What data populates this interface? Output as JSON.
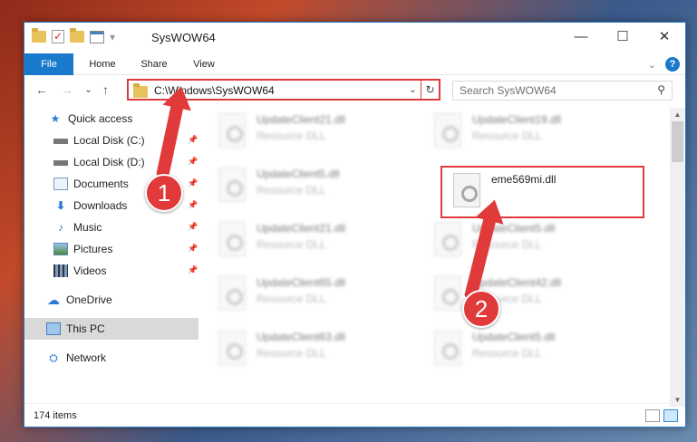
{
  "window": {
    "title": "SysWOW64",
    "qat_overflow": "▾",
    "minimize": "—",
    "maximize": "☐",
    "close": "✕"
  },
  "ribbon": {
    "tabs": [
      "File",
      "Home",
      "Share",
      "View"
    ],
    "expand": "⌄",
    "help": "?"
  },
  "nav": {
    "back": "←",
    "forward": "→",
    "recent": "⌄",
    "up": "↑",
    "address": "C:\\Windows\\SysWOW64",
    "address_dropdown": "⌄",
    "refresh": "↻",
    "search_placeholder": "Search SysWOW64",
    "search_icon": "⚲"
  },
  "sidebar": {
    "items": [
      {
        "label": "Quick access",
        "icon": "star-icon"
      },
      {
        "label": "Local Disk (C:)",
        "icon": "drive-icon",
        "pinned": true
      },
      {
        "label": "Local Disk (D:)",
        "icon": "drive-icon",
        "pinned": true
      },
      {
        "label": "Documents",
        "icon": "documents-icon",
        "pinned": true
      },
      {
        "label": "Downloads",
        "icon": "download-icon",
        "pinned": true
      },
      {
        "label": "Music",
        "icon": "music-icon",
        "pinned": true
      },
      {
        "label": "Pictures",
        "icon": "pictures-icon",
        "pinned": true
      },
      {
        "label": "Videos",
        "icon": "videos-icon",
        "pinned": true
      },
      {
        "label": "OneDrive",
        "icon": "cloud-icon"
      },
      {
        "label": "This PC",
        "icon": "computer-icon",
        "selected": true
      },
      {
        "label": "Network",
        "icon": "network-icon"
      }
    ]
  },
  "files": {
    "left": [
      {
        "name": "UpdateClient21.dll",
        "type": "Resource DLL"
      },
      {
        "name": "UpdateClient5.dll",
        "type": "Resource DLL"
      },
      {
        "name": "UpdateClient21.dll",
        "type": "Resource DLL"
      },
      {
        "name": "UpdateClient65.dll",
        "type": "Resource DLL"
      },
      {
        "name": "UpdateClient63.dll",
        "type": "Resource DLL"
      }
    ],
    "right": [
      {
        "name": "UpdateClient19.dll",
        "type": "Resource DLL"
      },
      {
        "name": "UpdateClient5.dll",
        "type": "Resource DLL"
      },
      {
        "name": "UpdateClient42.dll",
        "type": "Resource DLL"
      },
      {
        "name": "UpdateClient5.dll",
        "type": "Resource DLL"
      }
    ],
    "highlighted": {
      "name": "eme569mi.dll",
      "icon": "gears-icon"
    }
  },
  "status": {
    "item_count": "174 items"
  },
  "annotations": {
    "step1": "1",
    "step2": "2"
  },
  "colors": {
    "accent": "#1979ca",
    "annotation": "#e03a3a"
  }
}
